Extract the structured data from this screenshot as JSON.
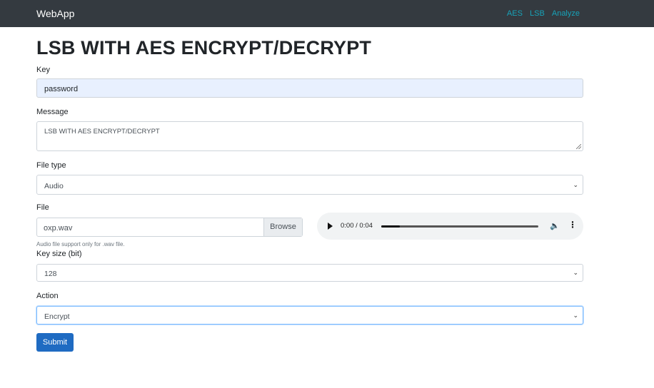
{
  "navbar": {
    "brand": "WebApp",
    "links": [
      "AES",
      "LSB",
      "Analyze"
    ]
  },
  "page": {
    "title": "LSB WITH AES ENCRYPT/DECRYPT"
  },
  "form": {
    "key": {
      "label": "Key",
      "value": "password"
    },
    "message": {
      "label": "Message",
      "value": "LSB WITH AES ENCRYPT/DECRYPT"
    },
    "file_type": {
      "label": "File type",
      "selected": "Audio"
    },
    "file": {
      "label": "File",
      "filename": "oxp.wav",
      "browse_label": "Browse",
      "help_text": "Audio file support only for .wav file."
    },
    "audio_player": {
      "time": "0:00 / 0:04",
      "progress_fraction": 0.12,
      "icons": {
        "play": "play-icon",
        "volume": "volume-icon",
        "more": "more-options-icon"
      }
    },
    "key_size": {
      "label": "Key size (bit)",
      "selected": "128"
    },
    "action": {
      "label": "Action",
      "selected": "Encrypt"
    },
    "submit_label": "Submit"
  },
  "colors": {
    "navbar_bg": "#343a40",
    "nav_link": "#17a2b8",
    "autofill_bg": "#e8f0fe",
    "submit_bg": "#1f6bc2",
    "focus_border": "#80bdff"
  }
}
